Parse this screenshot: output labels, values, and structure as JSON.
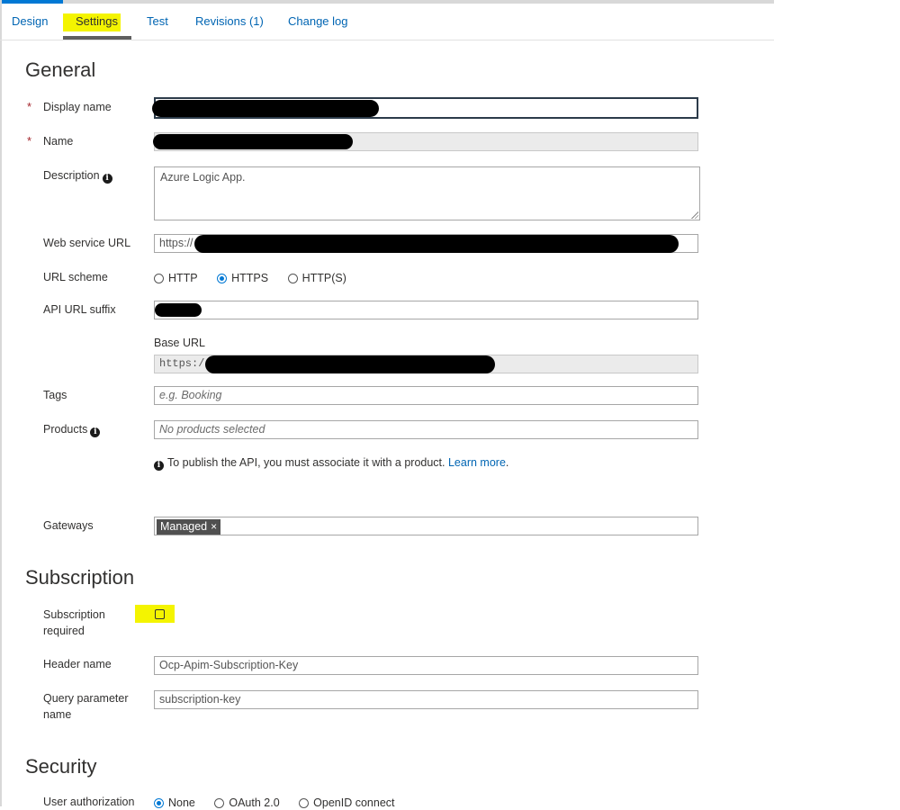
{
  "tabs": [
    {
      "label": "Design"
    },
    {
      "label": "Settings"
    },
    {
      "label": "Test"
    },
    {
      "label": "Revisions (1)"
    },
    {
      "label": "Change log"
    }
  ],
  "general": {
    "title": "General",
    "display_name_label": "Display name",
    "name_label": "Name",
    "required_mark": "*",
    "description_label": "Description",
    "description_value": "Azure Logic App.",
    "web_service_url_label": "Web service URL",
    "web_service_url_prefix": "https://",
    "url_scheme_label": "URL scheme",
    "url_scheme_options": [
      "HTTP",
      "HTTPS",
      "HTTP(S)"
    ],
    "url_scheme_selected": "HTTPS",
    "api_url_suffix_label": "API URL suffix",
    "base_url_label": "Base URL",
    "base_url_prefix": "https:/",
    "tags_label": "Tags",
    "tags_placeholder": "e.g. Booking",
    "products_label": "Products",
    "products_placeholder": "No products selected",
    "products_note": "To publish the API, you must associate it with a product.",
    "learn_more": "Learn more",
    "gateways_label": "Gateways",
    "gateway_chip": "Managed",
    "chip_remove": "×",
    "info_glyph": "i"
  },
  "subscription": {
    "title": "Subscription",
    "required_label_line1": "Subscription",
    "required_label_line2": "required",
    "required_checked": false,
    "header_name_label": "Header name",
    "header_name_value": "Ocp-Apim-Subscription-Key",
    "query_param_label_line1": "Query parameter",
    "query_param_label_line2": "name",
    "query_param_value": "subscription-key"
  },
  "security": {
    "title": "Security",
    "user_auth_label": "User authorization",
    "user_auth_options": [
      "None",
      "OAuth 2.0",
      "OpenID connect"
    ],
    "user_auth_selected": "None"
  },
  "colors": {
    "link": "#0065b3",
    "accent": "#0078d4",
    "highlight": "#f4f400",
    "required": "#a4262c"
  }
}
